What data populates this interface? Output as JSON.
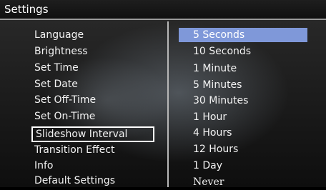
{
  "header": {
    "title": "Settings"
  },
  "menu": {
    "items": [
      {
        "label": "Language"
      },
      {
        "label": "Brightness"
      },
      {
        "label": "Set Time"
      },
      {
        "label": "Set Date"
      },
      {
        "label": "Set Off-Time"
      },
      {
        "label": "Set On-Time"
      },
      {
        "label": "Slideshow Interval"
      },
      {
        "label": "Transition Effect"
      },
      {
        "label": "Info"
      },
      {
        "label": "Default Settings"
      }
    ],
    "selected_index": 6
  },
  "options": {
    "items": [
      {
        "label": "5 Seconds"
      },
      {
        "label": "10 Seconds"
      },
      {
        "label": "1 Minute"
      },
      {
        "label": "5 Minutes"
      },
      {
        "label": "30 Minutes"
      },
      {
        "label": "1 Hour"
      },
      {
        "label": "4 Hours"
      },
      {
        "label": "12 Hours"
      },
      {
        "label": "1 Day"
      },
      {
        "label": "Never"
      }
    ],
    "highlighted_index": 0
  },
  "colors": {
    "highlight": "#7f98d9",
    "text": "#f2f2f2"
  }
}
